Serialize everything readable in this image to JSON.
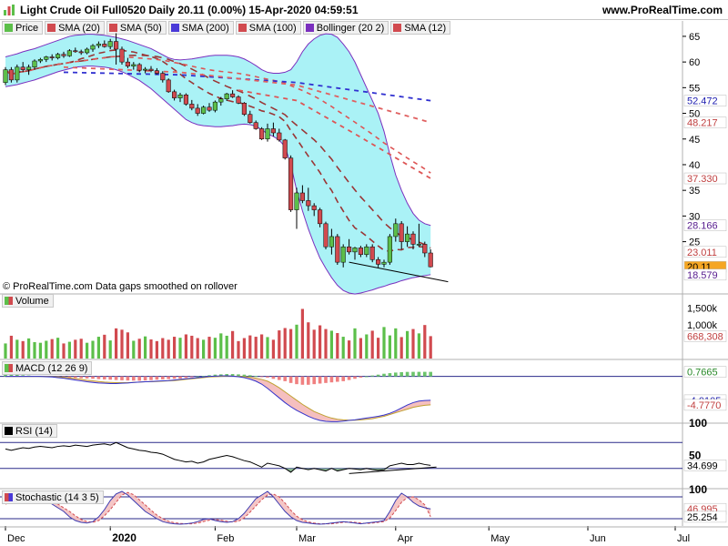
{
  "title": "Light Crude Oil Full0520 Daily 20.11 (0.00%) 15-Apr-2020 04:59:51",
  "url": "www.ProRealTime.com",
  "colors": {
    "up": "#5cbf4a",
    "down": "#d14a4f",
    "bollinger_fill": "#aaf2f6",
    "bollinger_line": "#7b2fbe",
    "sma20": "#9b3535",
    "sma50": "#dd5555",
    "sma100": "#e06060",
    "sma200": "#3030d0",
    "macd_hist_pos": "#6cc46c",
    "macd_hist_neg": "#f08080"
  },
  "legend": [
    {
      "label": "Price",
      "color": "#5cbf4a"
    },
    {
      "label": "SMA (20)",
      "color": "#d14a4f"
    },
    {
      "label": "SMA (50)",
      "color": "#d14a4f"
    },
    {
      "label": "SMA (200)",
      "color": "#4a3ad8"
    },
    {
      "label": "SMA (100)",
      "color": "#d14a4f"
    },
    {
      "label": "Bollinger (20 2)",
      "color": "#7b2fbe"
    },
    {
      "label": "SMA (12)",
      "color": "#d14a4f"
    }
  ],
  "footnote": "© ProRealTime.com  Data gaps smoothed on rollover",
  "panes": {
    "volume": {
      "label": "Volume"
    },
    "macd": {
      "label": "MACD (12 26 9)"
    },
    "rsi": {
      "label": "RSI (14)"
    },
    "stochastic": {
      "label": "Stochastic (14 3 5)"
    }
  },
  "chart_data": [
    {
      "type": "candlestick",
      "name": "Price",
      "ylim": [
        15,
        68
      ],
      "yticks": [
        "65",
        "60",
        "55",
        "50",
        "45",
        "40",
        "35",
        "30",
        "25"
      ],
      "xticks": [
        "Dec",
        "2020",
        "Feb",
        "Mar",
        "Apr",
        "May",
        "Jun",
        "Jul"
      ],
      "value_labels": [
        "52.472",
        "48.217",
        "37.330",
        "28.166",
        "23.011",
        "20.11",
        "18.579"
      ],
      "candles": [
        [
          56.0,
          59.0,
          55.5,
          58.5
        ],
        [
          58.5,
          59.0,
          56.0,
          56.5
        ],
        [
          56.5,
          59.5,
          56.0,
          59.0
        ],
        [
          59.0,
          60.0,
          58.0,
          58.5
        ],
        [
          58.5,
          59.5,
          57.5,
          59.0
        ],
        [
          59.0,
          60.5,
          58.5,
          60.2
        ],
        [
          60.2,
          60.8,
          59.8,
          60.5
        ],
        [
          60.5,
          61.2,
          60.0,
          61.0
        ],
        [
          61.0,
          61.5,
          60.3,
          60.8
        ],
        [
          60.8,
          61.8,
          60.5,
          61.5
        ],
        [
          61.5,
          62.0,
          60.8,
          61.2
        ],
        [
          61.2,
          62.5,
          61.0,
          62.2
        ],
        [
          62.2,
          62.8,
          61.8,
          62.0
        ],
        [
          62.0,
          62.4,
          61.4,
          61.8
        ],
        [
          61.8,
          62.8,
          61.5,
          62.5
        ],
        [
          62.5,
          63.5,
          62.0,
          63.2
        ],
        [
          63.2,
          64.0,
          62.7,
          63.5
        ],
        [
          63.5,
          64.2,
          62.8,
          63.0
        ],
        [
          63.0,
          64.5,
          62.5,
          64.0
        ],
        [
          64.0,
          65.6,
          59.5,
          62.5
        ],
        [
          62.5,
          63.0,
          59.5,
          60.0
        ],
        [
          60.0,
          60.8,
          58.8,
          59.2
        ],
        [
          59.2,
          60.0,
          58.5,
          59.5
        ],
        [
          59.5,
          59.8,
          58.0,
          58.4
        ],
        [
          58.4,
          59.0,
          57.8,
          58.6
        ],
        [
          58.6,
          59.2,
          58.0,
          58.3
        ],
        [
          58.3,
          58.8,
          57.5,
          57.8
        ],
        [
          57.8,
          58.2,
          56.0,
          56.5
        ],
        [
          56.5,
          56.8,
          54.0,
          54.2
        ],
        [
          54.2,
          54.6,
          52.5,
          53.0
        ],
        [
          53.0,
          54.0,
          52.2,
          53.6
        ],
        [
          53.6,
          53.9,
          51.5,
          51.8
        ],
        [
          51.8,
          52.6,
          50.6,
          51.0
        ],
        [
          51.0,
          51.8,
          49.5,
          50.0
        ],
        [
          50.0,
          51.5,
          49.8,
          51.2
        ],
        [
          51.2,
          52.0,
          50.3,
          50.6
        ],
        [
          50.6,
          52.5,
          50.2,
          52.2
        ],
        [
          52.2,
          53.2,
          51.5,
          52.8
        ],
        [
          52.8,
          54.0,
          52.4,
          53.8
        ],
        [
          53.8,
          54.5,
          53.0,
          53.2
        ],
        [
          53.2,
          53.5,
          51.8,
          52.0
        ],
        [
          52.0,
          52.2,
          49.5,
          49.8
        ],
        [
          49.8,
          50.5,
          48.0,
          48.2
        ],
        [
          48.2,
          48.6,
          46.8,
          47.0
        ],
        [
          47.0,
          47.3,
          44.8,
          45.0
        ],
        [
          45.0,
          48.0,
          44.5,
          47.0
        ],
        [
          47.0,
          48.2,
          45.5,
          46.2
        ],
        [
          46.2,
          47.0,
          44.5,
          44.8
        ],
        [
          44.8,
          45.0,
          41.0,
          41.3
        ],
        [
          41.3,
          41.8,
          30.8,
          31.2
        ],
        [
          31.2,
          35.5,
          27.5,
          34.5
        ],
        [
          34.5,
          36.0,
          32.5,
          33.0
        ],
        [
          33.0,
          35.5,
          31.0,
          32.0
        ],
        [
          32.0,
          32.5,
          30.0,
          31.2
        ],
        [
          31.2,
          31.6,
          27.8,
          28.5
        ],
        [
          28.5,
          28.9,
          23.5,
          24.0
        ],
        [
          24.0,
          27.5,
          22.5,
          26.0
        ],
        [
          26.0,
          26.5,
          20.5,
          21.0
        ],
        [
          21.0,
          24.5,
          20.0,
          24.0
        ],
        [
          24.0,
          25.5,
          22.5,
          23.0
        ],
        [
          23.0,
          24.0,
          21.5,
          23.8
        ],
        [
          23.8,
          24.2,
          22.0,
          22.5
        ],
        [
          22.5,
          24.5,
          22.0,
          24.0
        ],
        [
          24.0,
          24.5,
          21.0,
          21.5
        ],
        [
          21.5,
          22.0,
          20.0,
          20.6
        ],
        [
          20.6,
          21.5,
          20.0,
          21.0
        ],
        [
          21.0,
          26.5,
          20.5,
          26.0
        ],
        [
          26.0,
          29.5,
          25.0,
          28.5
        ],
        [
          28.5,
          29.0,
          23.5,
          25.0
        ],
        [
          25.0,
          28.0,
          24.0,
          26.5
        ],
        [
          26.5,
          27.0,
          23.5,
          24.5
        ],
        [
          24.5,
          28.5,
          24.0,
          24.5
        ],
        [
          24.5,
          25.0,
          22.0,
          22.8
        ],
        [
          22.8,
          23.5,
          20.0,
          20.11
        ]
      ],
      "bollinger_upper": [
        61,
        61.3,
        61.6,
        62,
        62.3,
        62.6,
        63,
        63.4,
        63.8,
        64.2,
        64.6,
        65,
        65.2,
        65.3,
        65.4,
        65.4,
        65.3,
        65.2,
        65,
        64.8,
        64.5,
        64.2,
        63.8,
        63.4,
        63,
        62.6,
        62,
        61.4,
        60.8,
        60.5,
        60.4,
        60.5,
        60.6,
        60.8,
        61,
        61.2,
        61.3,
        61.3,
        61.3,
        61.2,
        61,
        60.6,
        60,
        59.3,
        58.5,
        58,
        57.8,
        57.8,
        58,
        58.5,
        60,
        62,
        63.5,
        64.5,
        65.2,
        65.5,
        65.4,
        64.8,
        63.5,
        62,
        60,
        57.5,
        55,
        52.5,
        50,
        46.5,
        42,
        38,
        35,
        32.5,
        30.5,
        29.2,
        28.5,
        28.166
      ],
      "bollinger_lower": [
        55.2,
        55.4,
        55.6,
        55.9,
        56.2,
        56.5,
        56.9,
        57.3,
        57.7,
        58.1,
        58.4,
        58.7,
        59,
        59.1,
        59.2,
        59.2,
        59.1,
        59,
        58.8,
        58.5,
        58.1,
        57.6,
        57,
        56.4,
        55.6,
        54.8,
        53.8,
        52.8,
        51.8,
        50.8,
        49.8,
        48.8,
        48.2,
        47.8,
        47.6,
        47.5,
        47.4,
        47.4,
        47.5,
        47.6,
        47.8,
        47.9,
        47.8,
        47.5,
        46.8,
        46,
        45.5,
        44.8,
        43.5,
        40,
        35,
        31,
        27.5,
        24.5,
        21.8,
        19.8,
        18,
        16.5,
        15.5,
        15,
        14.8,
        15,
        15.3,
        15.6,
        16,
        16.3,
        16.7,
        17,
        17.4,
        17.7,
        18,
        18.2,
        18.4,
        18.579
      ]
    },
    {
      "type": "bar",
      "name": "Volume",
      "ylim": [
        0,
        1900
      ],
      "yticks": [
        "1,500k",
        "1,000k"
      ],
      "value_label": "668,308",
      "values": [
        450,
        680,
        560,
        520,
        600,
        490,
        470,
        530,
        580,
        620,
        450,
        500,
        560,
        590,
        470,
        530,
        650,
        710,
        540,
        900,
        860,
        780,
        530,
        590,
        660,
        570,
        520,
        610,
        560,
        650,
        620,
        720,
        680,
        610,
        560,
        650,
        620,
        750,
        680,
        820,
        520,
        610,
        690,
        650,
        720,
        640,
        560,
        840,
        910,
        880,
        1010,
        1480,
        1080,
        860,
        990,
        880,
        830,
        760,
        650,
        540,
        900,
        610,
        720,
        830,
        620,
        940,
        690,
        900,
        640,
        820,
        880,
        750,
        1000,
        668
      ]
    },
    {
      "type": "bar+line",
      "name": "MACD",
      "ylim": [
        -7.7,
        2.7
      ],
      "value_labels": [
        "0.7665",
        "-4.0105",
        "-4.7770"
      ],
      "histogram": [
        0.35,
        0.3,
        0.25,
        0.2,
        0.15,
        0.1,
        0.05,
        0,
        -0.05,
        -0.1,
        -0.15,
        -0.2,
        -0.25,
        -0.3,
        -0.35,
        -0.4,
        -0.45,
        -0.5,
        -0.55,
        -0.6,
        -0.65,
        -0.68,
        -0.7,
        -0.72,
        -0.68,
        -0.62,
        -0.55,
        -0.5,
        -0.45,
        -0.4,
        -0.35,
        -0.25,
        -0.15,
        0,
        0.1,
        0.2,
        0.3,
        0.35,
        0.4,
        0.4,
        0.35,
        0.3,
        0.2,
        0.1,
        -0.05,
        -0.2,
        -0.4,
        -0.6,
        -0.8,
        -1.1,
        -1.3,
        -1.4,
        -1.4,
        -1.3,
        -1.2,
        -1.1,
        -1,
        -0.9,
        -0.8,
        -0.6,
        -0.4,
        -0.2,
        0,
        0.15,
        0.3,
        0.45,
        0.55,
        0.65,
        0.72,
        0.76,
        0.77,
        0.77,
        0.77,
        0.7665
      ],
      "macd": [
        0,
        0,
        0,
        0,
        0,
        0,
        0,
        -0.05,
        -0.1,
        -0.2,
        -0.3,
        -0.45,
        -0.6,
        -0.75,
        -0.9,
        -1,
        -1.1,
        -1.15,
        -1.2,
        -1.2,
        -1.15,
        -1.1,
        -1,
        -0.95,
        -0.9,
        -0.85,
        -0.8,
        -0.75,
        -0.7,
        -0.6,
        -0.5,
        -0.4,
        -0.3,
        -0.2,
        -0.1,
        0,
        0.05,
        0.1,
        0.1,
        0.05,
        -0.05,
        -0.2,
        -0.45,
        -0.8,
        -1.3,
        -2,
        -2.8,
        -3.6,
        -4.4,
        -5.1,
        -5.7,
        -6.2,
        -6.7,
        -7.1,
        -7.4,
        -7.55,
        -7.6,
        -7.6,
        -7.5,
        -7.4,
        -7.3,
        -7.15,
        -7,
        -6.85,
        -6.7,
        -6.5,
        -6.2,
        -5.8,
        -5.3,
        -4.8,
        -4.4,
        -4.15,
        -4.05,
        -4.0105
      ],
      "signal": [
        0,
        0,
        0,
        0,
        0,
        0,
        0,
        0,
        -0.05,
        -0.1,
        -0.15,
        -0.25,
        -0.35,
        -0.5,
        -0.65,
        -0.75,
        -0.85,
        -0.95,
        -1,
        -1.05,
        -1.05,
        -1.05,
        -1,
        -0.95,
        -0.9,
        -0.9,
        -0.85,
        -0.8,
        -0.75,
        -0.7,
        -0.6,
        -0.5,
        -0.4,
        -0.3,
        -0.2,
        -0.1,
        -0.05,
        0,
        0.05,
        0.05,
        0,
        -0.05,
        -0.15,
        -0.3,
        -0.5,
        -0.8,
        -1.3,
        -1.9,
        -2.6,
        -3.3,
        -4,
        -4.7,
        -5.3,
        -5.9,
        -6.3,
        -6.7,
        -7,
        -7.2,
        -7.3,
        -7.35,
        -7.35,
        -7.3,
        -7.2,
        -7.1,
        -6.9,
        -6.7,
        -6.4,
        -6.1,
        -5.8,
        -5.5,
        -5.2,
        -5,
        -4.85,
        -4.777
      ]
    },
    {
      "type": "line",
      "name": "RSI",
      "ylim": [
        0,
        100
      ],
      "yticks": [
        "100",
        "50"
      ],
      "reference_lines": [
        70,
        30
      ],
      "value_label": "34.699",
      "values": [
        60,
        58,
        60,
        62,
        61,
        63,
        64,
        63,
        62,
        64,
        65,
        64,
        66,
        65,
        64,
        66,
        67,
        68,
        66,
        70,
        66,
        62,
        60,
        58,
        57,
        55,
        54,
        52,
        48,
        44,
        42,
        40,
        41,
        38,
        40,
        44,
        46,
        48,
        50,
        48,
        45,
        42,
        40,
        36,
        32,
        38,
        36,
        34,
        30,
        24,
        32,
        30,
        28,
        30,
        28,
        26,
        30,
        26,
        28,
        30,
        29,
        28,
        30,
        28,
        27,
        28,
        34,
        36,
        38,
        36,
        36,
        38,
        36,
        34.699
      ],
      "trendline": [
        [
          59,
          22
        ],
        [
          74,
          32
        ]
      ]
    },
    {
      "type": "line",
      "name": "Stochastic",
      "ylim": [
        0,
        100
      ],
      "yticks": [
        "100",
        "50"
      ],
      "reference_lines": [
        80,
        20
      ],
      "value_labels": [
        "46.995",
        "25.254"
      ],
      "k": [
        70,
        75,
        80,
        82,
        85,
        80,
        75,
        70,
        60,
        50,
        40,
        25,
        15,
        10,
        8,
        12,
        25,
        45,
        70,
        88,
        95,
        85,
        70,
        55,
        40,
        30,
        20,
        12,
        8,
        6,
        5,
        6,
        8,
        12,
        18,
        20,
        15,
        12,
        10,
        12,
        20,
        35,
        55,
        75,
        85,
        95,
        80,
        60,
        40,
        25,
        15,
        10,
        8,
        6,
        5,
        6,
        8,
        10,
        12,
        10,
        8,
        6,
        8,
        10,
        12,
        15,
        40,
        70,
        90,
        80,
        65,
        55,
        50,
        46.995
      ],
      "d": [
        60,
        65,
        70,
        76,
        80,
        82,
        80,
        76,
        70,
        60,
        50,
        40,
        28,
        18,
        12,
        10,
        15,
        28,
        45,
        65,
        85,
        92,
        86,
        72,
        58,
        43,
        30,
        20,
        13,
        9,
        7,
        6,
        6,
        8,
        12,
        16,
        18,
        16,
        13,
        11,
        13,
        22,
        38,
        55,
        72,
        85,
        88,
        80,
        63,
        43,
        27,
        17,
        11,
        8,
        6,
        6,
        6,
        8,
        10,
        11,
        10,
        8,
        7,
        8,
        10,
        12,
        22,
        42,
        65,
        78,
        80,
        72,
        58,
        25.254
      ]
    }
  ]
}
